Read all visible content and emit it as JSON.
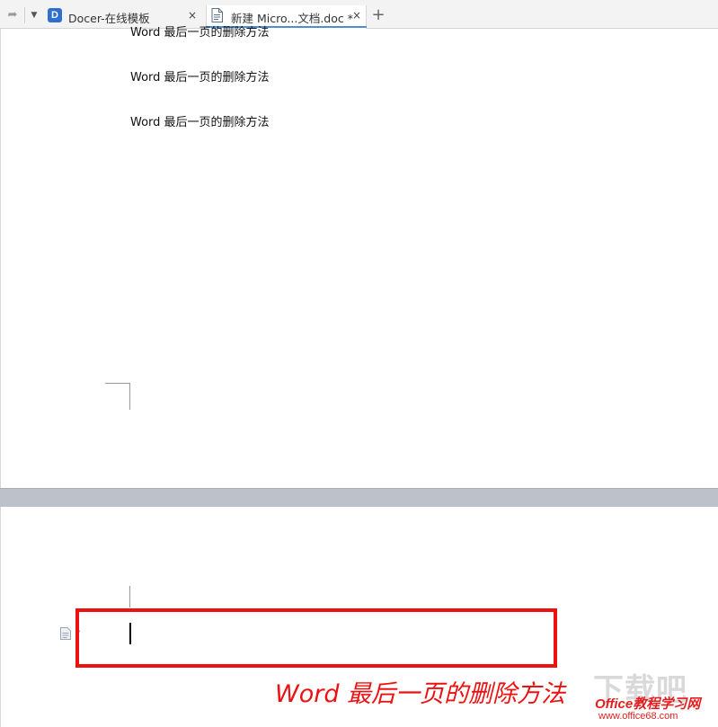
{
  "tabbar": {
    "tabs": [
      {
        "label": "Docer-在线模板",
        "icon": "docer-logo-icon",
        "icon_text": "D"
      },
      {
        "label": "新建 Micro...文档.doc *",
        "icon": "doc-file-icon",
        "active": true
      }
    ],
    "close_glyph": "×",
    "new_tab_glyph": "+",
    "redo_glyph": "➦",
    "dropdown_glyph": "▼"
  },
  "document": {
    "page1_lines": [
      "Word 最后一页的删除方法",
      "Word 最后一页的删除方法",
      "Word 最后一页的删除方法"
    ]
  },
  "annotation": {
    "caption": "Word 最后一页的删除方法",
    "highlight_color": "#ee1111"
  },
  "watermark": {
    "large": "下载吧",
    "brand": "Office教程学习网",
    "url": "www.office68.com"
  },
  "colors": {
    "accent": "#4b8fd6",
    "page_gap": "#bcc1ca"
  }
}
